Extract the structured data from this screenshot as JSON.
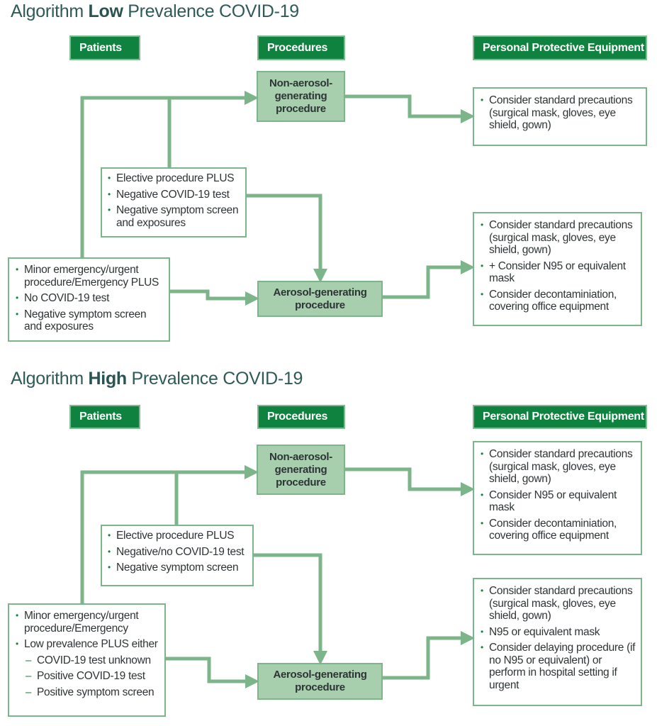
{
  "colors": {
    "header_bg": "#0f8240",
    "procedure_bg": "#a8cfad",
    "connector": "#7db58b",
    "title_text": "#2e5a58",
    "bullet": "#0f8240"
  },
  "sections": [
    {
      "title_prefix": "Algorithm ",
      "title_bold": "Low",
      "title_suffix": " Prevalence COVID-19",
      "headers": {
        "patients": "Patients",
        "procedures": "Procedures",
        "ppe": "Personal Protective Equipment"
      },
      "procedures": {
        "non_aerosol": "Non-aerosol-generating procedure",
        "aerosol": "Aerosol-generating procedure"
      },
      "elective_box": [
        {
          "text": "Elective procedure PLUS",
          "type": "bullet"
        },
        {
          "text": "Negative COVID-19 test",
          "type": "bullet"
        },
        {
          "text": "Negative symptom screen and exposures",
          "type": "bullet"
        }
      ],
      "minor_box": [
        {
          "text": "Minor emergency/urgent procedure/Emergency PLUS",
          "type": "bullet"
        },
        {
          "text": "No COVID-19 test",
          "type": "bullet"
        },
        {
          "text": "Negative symptom screen and exposures",
          "type": "bullet"
        }
      ],
      "ppe_non_aerosol": [
        {
          "text": "Consider standard precautions (surgical mask, gloves, eye shield, gown)",
          "type": "bullet"
        }
      ],
      "ppe_aerosol": [
        {
          "text": "Consider standard precautions (surgical mask, gloves, eye shield, gown)",
          "type": "bullet"
        },
        {
          "text": "+ Consider N95 or equivalent mask",
          "type": "bullet"
        },
        {
          "text": "Consider decontaminiation, covering office equipment",
          "type": "bullet"
        }
      ]
    },
    {
      "title_prefix": "Algorithm ",
      "title_bold": "High",
      "title_suffix": " Prevalence COVID-19",
      "headers": {
        "patients": "Patients",
        "procedures": "Procedures",
        "ppe": "Personal Protective Equipment"
      },
      "procedures": {
        "non_aerosol": "Non-aerosol-generating procedure",
        "aerosol": "Aerosol-generating procedure"
      },
      "elective_box": [
        {
          "text": "Elective procedure PLUS",
          "type": "bullet"
        },
        {
          "text": "Negative/no COVID-19 test",
          "type": "bullet"
        },
        {
          "text": "Negative symptom screen",
          "type": "bullet"
        }
      ],
      "minor_box": [
        {
          "text": "Minor emergency/urgent procedure/Emergency",
          "type": "bullet"
        },
        {
          "text": "Low prevalence PLUS either",
          "type": "bullet"
        },
        {
          "text": "COVID-19 test unknown",
          "type": "sub"
        },
        {
          "text": "Positive COVID-19 test",
          "type": "sub"
        },
        {
          "text": "Positive symptom screen",
          "type": "sub"
        }
      ],
      "ppe_non_aerosol": [
        {
          "text": "Consider standard precautions (surgical mask, gloves, eye shield, gown)",
          "type": "bullet"
        },
        {
          "text": "Consider N95 or equivalent mask",
          "type": "bullet"
        },
        {
          "text": "Consider decontaminiation, covering office equipment",
          "type": "bullet"
        }
      ],
      "ppe_aerosol": [
        {
          "text": "Consider standard precautions (surgical mask, gloves, eye shield, gown)",
          "type": "bullet"
        },
        {
          "text": "N95 or equivalent mask",
          "type": "bullet"
        },
        {
          "text": "Consider delaying procedure (if no N95 or equivalent) or perform in hospital setting if urgent",
          "type": "bullet"
        }
      ]
    }
  ]
}
